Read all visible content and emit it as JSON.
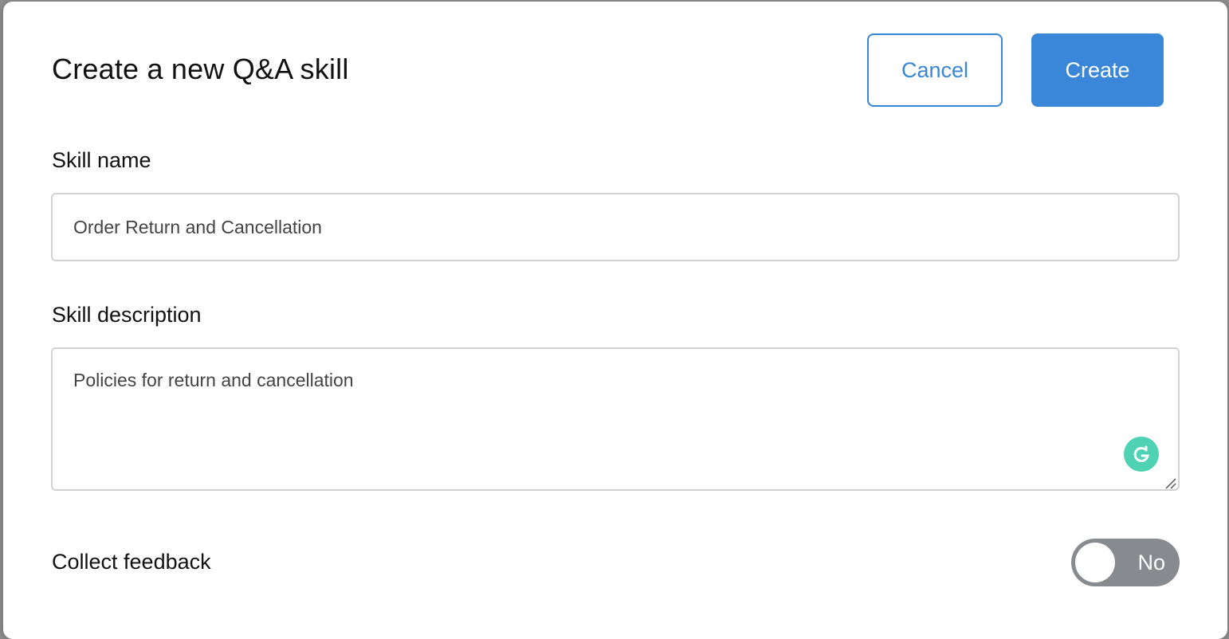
{
  "dialog": {
    "title": "Create a new Q&A skill",
    "cancel_label": "Cancel",
    "create_label": "Create"
  },
  "form": {
    "skill_name": {
      "label": "Skill name",
      "value": "Order Return and Cancellation"
    },
    "skill_description": {
      "label": "Skill description",
      "value": "Policies for return and cancellation"
    },
    "collect_feedback": {
      "label": "Collect feedback",
      "state_label": "No",
      "enabled": false
    }
  },
  "icons": {
    "grammarly": "grammarly-icon",
    "resize": "resize-handle-icon"
  },
  "colors": {
    "accent": "#3a86d8",
    "toggle_off": "#878b90",
    "grammarly": "#15c39a"
  }
}
